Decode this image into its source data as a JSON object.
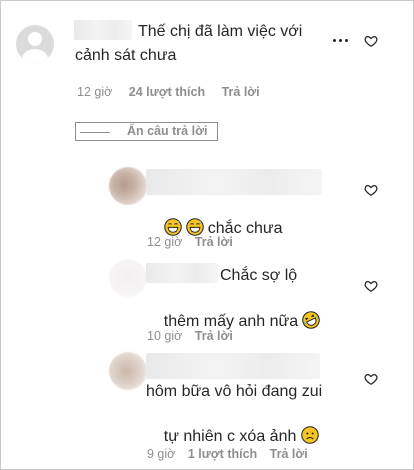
{
  "comments": [
    {
      "text_line1": "Thế chị đã làm việc với",
      "text_line2": "cảnh sát chưa",
      "time": "12 giờ",
      "likes": "24 lượt thích",
      "reply": "Trả lời"
    }
  ],
  "hide_replies": "Ẩn câu trả lời",
  "replies": [
    {
      "text": "chắc chưa",
      "emojis": [
        "grinning-sweat-emoji",
        "grinning-sweat-emoji"
      ],
      "time": "12 giờ",
      "reply": "Trả lời"
    },
    {
      "text_line1": "Chắc sợ lộ",
      "text_line2": "thêm mấy anh nữa",
      "emoji": "rolling-laughing-emoji",
      "time": "10 giờ",
      "reply": "Trả lời"
    },
    {
      "text_line1": "hôm bữa vô hỏi đang zui",
      "text_line2": "tự nhiên c xóa ảnh",
      "emoji": "sad-face-emoji",
      "time": "9 giờ",
      "likes": "1 lượt thích",
      "reply": "Trả lời"
    }
  ],
  "colors": {
    "text": "#262626",
    "meta": "#8e8e8e",
    "border": "#c9c9c9",
    "emoji_yellow": "#f7c325"
  }
}
